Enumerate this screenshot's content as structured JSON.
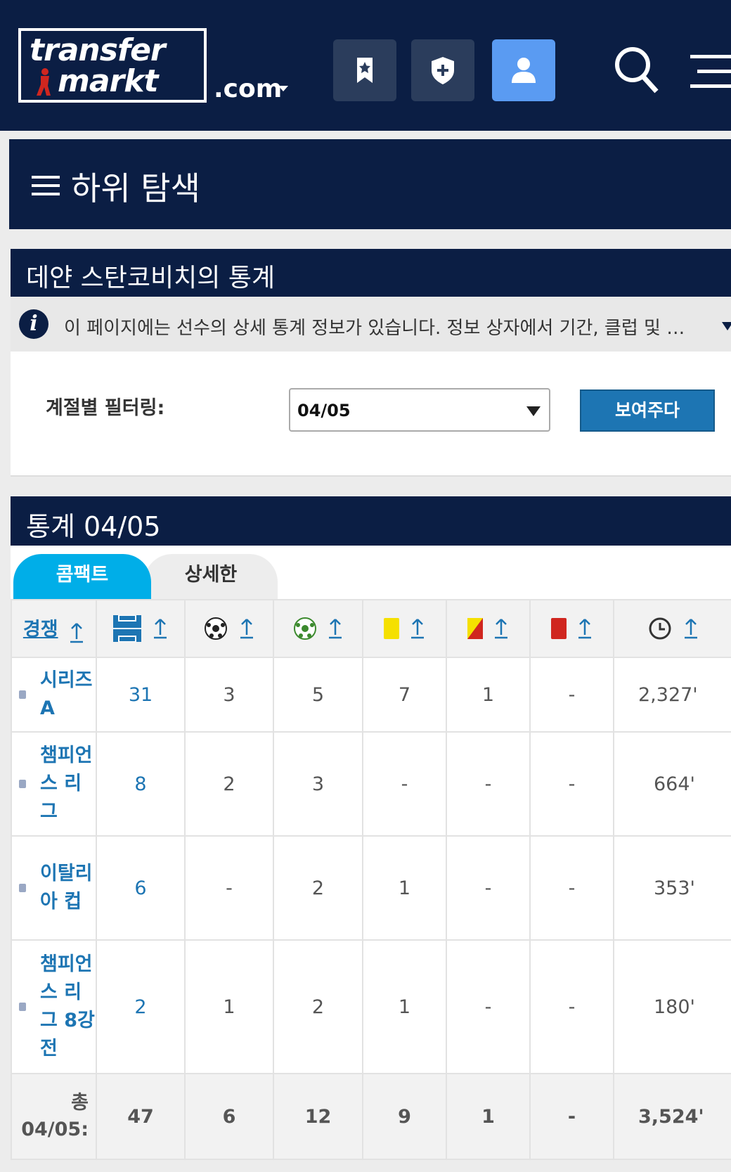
{
  "header": {
    "logo_line1": "transfer",
    "logo_line2": "markt",
    "logo_suffix": ".com",
    "colors": {
      "navy": "#0b1e44",
      "button": "#2b3d5c",
      "active_button": "#5a9bf2"
    }
  },
  "subnav": {
    "title": "하위 탐색"
  },
  "player_box": {
    "title": "데얀 스탄코비치의 통계",
    "info": "이 페이지에는 선수의 상세 통계 정보가 있습니다. 정보 상자에서 기간, 클럽 및 대회를 선택할 수 있습니다.",
    "filter_label": "계절별 필터링:",
    "season_value": "04/05",
    "show_button": "보여주다"
  },
  "stats_box": {
    "title": "통계 04/05",
    "tabs": [
      "콤팩트",
      "상세한"
    ],
    "columns": {
      "competition": "경쟁",
      "icons": [
        "appearances-icon",
        "goals-icon",
        "assists-icon",
        "yellow-card-icon",
        "second-yellow-icon",
        "red-card-icon",
        "minutes-icon"
      ]
    },
    "rows": [
      {
        "competition": "시리즈 A",
        "apps": "31",
        "goals": "3",
        "assists": "5",
        "yellow": "7",
        "second_yellow": "1",
        "red": "-",
        "minutes": "2,327'"
      },
      {
        "competition": "챔피언스 리그",
        "apps": "8",
        "goals": "2",
        "assists": "3",
        "yellow": "-",
        "second_yellow": "-",
        "red": "-",
        "minutes": "664'"
      },
      {
        "competition": "이탈리아 컵",
        "apps": "6",
        "goals": "-",
        "assists": "2",
        "yellow": "1",
        "second_yellow": "-",
        "red": "-",
        "minutes": "353'"
      },
      {
        "competition": "챔피언스 리그 8강전",
        "apps": "2",
        "goals": "1",
        "assists": "2",
        "yellow": "1",
        "second_yellow": "-",
        "red": "-",
        "minutes": "180'"
      }
    ],
    "total": {
      "label": "총 04/05:",
      "apps": "47",
      "goals": "6",
      "assists": "12",
      "yellow": "9",
      "second_yellow": "1",
      "red": "-",
      "minutes": "3,524'"
    }
  }
}
